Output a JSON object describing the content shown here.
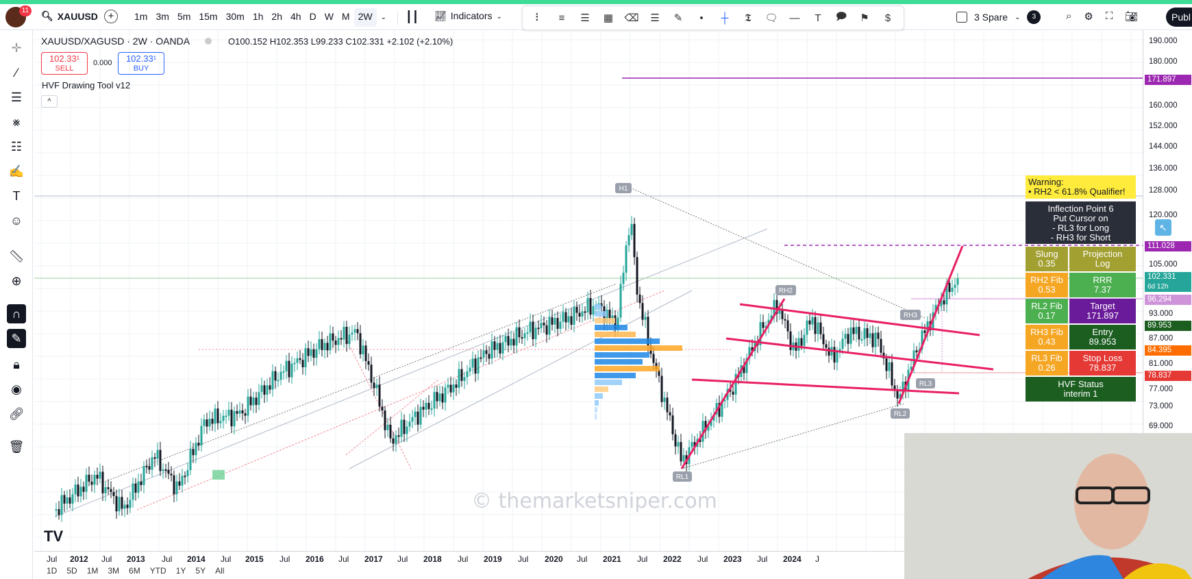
{
  "toolbar": {
    "notification_count": "11",
    "symbol": "XAUUSD",
    "intervals": [
      "1m",
      "3m",
      "5m",
      "15m",
      "30m",
      "1h",
      "2h",
      "4h",
      "D",
      "W",
      "M",
      "2W"
    ],
    "active_interval": "2W",
    "indicators_label": "Indicators",
    "layout_name": "3 Spare",
    "layout_count": "3",
    "publish_label": "Publ"
  },
  "legend": {
    "title": "XAUUSD/XAGUSD · 2W · OANDA",
    "ohlc": "O100.152 H102.353 L99.233 C102.331 +2.102 (+2.10%)"
  },
  "trade": {
    "sell_price": "102.33¹",
    "sell_label": "SELL",
    "spread": "0.000",
    "buy_price": "102.33¹",
    "buy_label": "BUY"
  },
  "study": {
    "name": "HVF Drawing Tool v12",
    "collapse": "^"
  },
  "price_axis": {
    "ticks": [
      "190.000",
      "180.000",
      "160.000",
      "152.000",
      "144.000",
      "136.000",
      "128.000",
      "120.000",
      "105.000",
      "93.000",
      "87.000",
      "81.000",
      "77.000",
      "73.000",
      "69.000"
    ],
    "tag_171": "171.897",
    "tag_111": "111.028",
    "tag_last": "102.331",
    "tag_countdown": "6d 12h",
    "tag_96": "96.294",
    "tag_89": "89.953",
    "tag_84": "84.395",
    "tag_78": "78.837"
  },
  "time_axis": [
    "Jul",
    "2012",
    "Jul",
    "2013",
    "Jul",
    "2014",
    "Jul",
    "2015",
    "Jul",
    "2016",
    "Jul",
    "2017",
    "Jul",
    "2018",
    "Jul",
    "2019",
    "Jul",
    "2020",
    "Jul",
    "2021",
    "Jul",
    "2022",
    "Jul",
    "2023",
    "Jul",
    "2024",
    "J"
  ],
  "bottom_bar": [
    "1D",
    "5D",
    "1M",
    "3M",
    "6M",
    "YTD",
    "1Y",
    "5Y",
    "All"
  ],
  "pattern_labels": {
    "h1": "H1",
    "rh2": "RH2",
    "rh3": "RH3",
    "rl1": "RL1",
    "rl2": "RL2",
    "rl3": "RL3"
  },
  "panel": {
    "warning_title": "Warning:",
    "warning_text": "• RH2 < 61.8% Qualifier!",
    "inflection_line1": "Inflection Point 6",
    "inflection_line2": "Put Cursor on",
    "inflection_line3": "- RL3 for Long",
    "inflection_line4": "- RH3 for Short",
    "slung_label": "Slung",
    "slung_value": "0.35",
    "projection_label": "Projection",
    "projection_value": "Log",
    "rh2_label": "RH2 Fib",
    "rh2_value": "0.53",
    "rrr_label": "RRR",
    "rrr_value": "7.37",
    "rl2_label": "RL2 Fib",
    "rl2_value": "0.17",
    "target_label": "Target",
    "target_value": "171.897",
    "rh3_label": "RH3 Fib",
    "rh3_value": "0.43",
    "entry_label": "Entry",
    "entry_value": "89.953",
    "rl3_label": "RL3 Fib",
    "rl3_value": "0.26",
    "stop_label": "Stop Loss",
    "stop_value": "78.837",
    "status_label": "HVF Status",
    "status_value": "interim 1"
  },
  "watermark": "© themarketsniper.com",
  "tv_logo": "TV",
  "colors": {
    "accent_green": "#3ddc97",
    "pattern_pink": "#e91e63",
    "target_purple": "#9c27b0",
    "warning_yellow": "#ffeb3b",
    "panel_dark": "#2a2e39",
    "panel_olive": "#a3a032",
    "panel_orange": "#f5a623",
    "panel_green": "#4caf50",
    "panel_dkgreen": "#1b5e20",
    "panel_red": "#e53935",
    "panel_purple": "#6a1b9a"
  }
}
